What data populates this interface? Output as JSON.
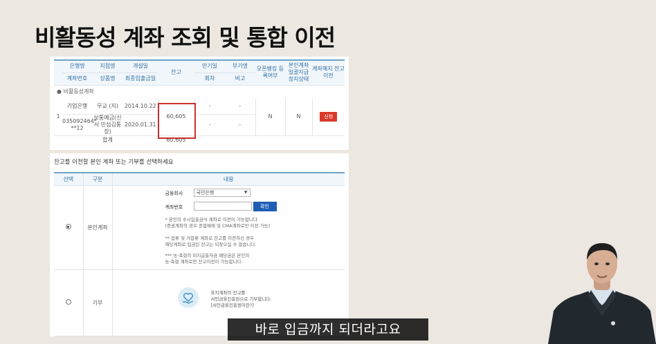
{
  "slide_title": "비활동성 계좌 조회 및 통합 이전",
  "account_table": {
    "headers_row1": [
      "은행명",
      "지점명",
      "개설일",
      "잔고",
      "만기일",
      "부기명",
      "오픈뱅킹 등록여부",
      "본인계좌 일괄지급 정지상태",
      "계좌해지 잔고이전"
    ],
    "headers_row2": [
      "계좌번호",
      "상품명",
      "최종입출금일",
      "회차",
      "비고"
    ],
    "section_label": "● 비활동성계좌",
    "row": {
      "no": "1",
      "bank": "기업은행",
      "branch": "무교 (지)",
      "open_date": "2014.10.22",
      "balance": "60,605",
      "maturity": "-",
      "memo": "-",
      "account_no": "035092464* **12",
      "product": "보통예금(신서 민섬김통장)",
      "last_tx": "2020.01.31",
      "round": "-",
      "note": "-",
      "openbanking": "N",
      "stop_status": "N",
      "action": "신청"
    },
    "total_label": "합계",
    "total_value": "60,605"
  },
  "transfer": {
    "title": "잔고를 이전할 본인 계좌 또는 기부를 선택하세요",
    "headers": [
      "선택",
      "구분",
      "내용"
    ],
    "own_label": "본인계좌",
    "institution_label": "금융회사",
    "institution_value": "국민은행",
    "account_label": "계좌번호",
    "account_value": "",
    "confirm": "확인",
    "note1": "* 본인의 수시입출금식 계좌로 이전이 가능합니다.\n(증권계좌의 경우 종합매매 및 CMA계좌로만 이전 가능)",
    "note2": "** 압류 및 가압류 계좌로 잔고를 이전하신 경우\n해당계좌로 입금된 잔고는 되찾으실 수 없습니다.",
    "note3": "*** 농·축협의 미지급출자금 배당금은 본인의\n농·축협 계좌로만 잔고이전이 가능합니다.",
    "donate_label": "기부",
    "donate_text": "휴지계좌의 잔고를\n서민금융진흥원으로 기부합니다.\n[서민금융진흥원이란?]"
  },
  "subtitle": "바로 입금까지 되더라고요",
  "colors": {
    "accent_blue": "#2d6fa8",
    "highlight_red": "#c9302c",
    "apply_red": "#d9382a",
    "confirm_blue": "#1d5eb5"
  }
}
